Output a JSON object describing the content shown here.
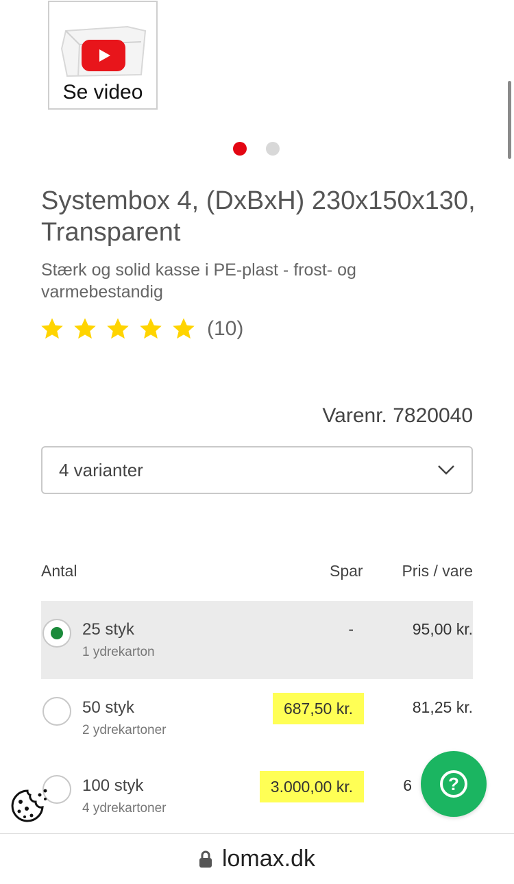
{
  "media": {
    "video_label": "Se video",
    "carousel_count": 2,
    "carousel_active": 1
  },
  "product": {
    "title": "Systembox 4, (DxBxH) 230x150x130, Transparent",
    "subtitle": "Stærk og solid kasse i PE-plast - frost- og varmebestandig",
    "rating": 5,
    "rating_count": "(10)",
    "sku": "Varenr. 7820040"
  },
  "variants": {
    "selected_label": "4 varianter"
  },
  "table": {
    "headers": {
      "quantity": "Antal",
      "save": "Spar",
      "price": "Pris / vare"
    },
    "rows": [
      {
        "qty": "25 styk",
        "carton": "1 ydrekarton",
        "save": "-",
        "price": "95,00 kr.",
        "selected": true,
        "highlight": false
      },
      {
        "qty": "50 styk",
        "carton": "2 ydrekartoner",
        "save": "687,50 kr.",
        "price": "81,25 kr.",
        "selected": false,
        "highlight": true
      },
      {
        "qty": "100 styk",
        "carton": "4 ydrekartoner",
        "save": "3.000,00 kr.",
        "price": "6",
        "selected": false,
        "highlight": true
      }
    ]
  },
  "widgets": {
    "help_icon": "question-mark-icon",
    "cookie_icon": "cookie-icon"
  },
  "browser": {
    "url": "lomax.dk"
  },
  "colors": {
    "accent_red": "#e30613",
    "star": "#ffd400",
    "help_green": "#1bb561",
    "radio_green": "#1a8a3a",
    "highlight": "#ffff55"
  }
}
